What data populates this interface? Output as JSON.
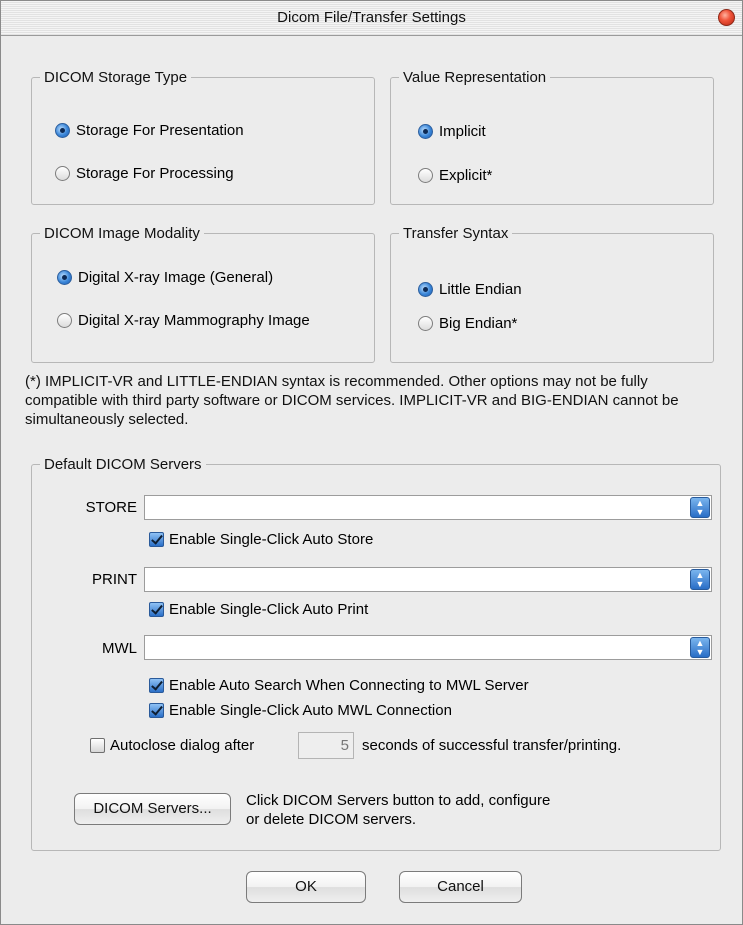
{
  "window": {
    "title": "Dicom File/Transfer Settings",
    "close_icon": "close-icon"
  },
  "storage_type": {
    "legend": "DICOM Storage Type",
    "options": [
      "Storage For Presentation",
      "Storage For Processing"
    ],
    "selected": 0
  },
  "value_representation": {
    "legend": "Value Representation",
    "options": [
      "Implicit",
      "Explicit*"
    ],
    "selected": 0
  },
  "modality": {
    "legend": "DICOM Image Modality",
    "options": [
      "Digital X-ray Image (General)",
      "Digital X-ray Mammography Image"
    ],
    "selected": 0
  },
  "transfer_syntax": {
    "legend": "Transfer Syntax",
    "options": [
      "Little Endian",
      "Big Endian*"
    ],
    "selected": 0
  },
  "note": "(*) IMPLICIT-VR  and LITTLE-ENDIAN syntax is recommended. Other options may not be fully compatible with third party software or DICOM services. IMPLICIT-VR and BIG-ENDIAN cannot be simultaneously selected.",
  "servers": {
    "legend": "Default DICOM Servers",
    "store_label": "STORE",
    "store_value": "",
    "store_check": "Enable Single-Click Auto Store",
    "print_label": "PRINT",
    "print_value": "",
    "print_check": "Enable Single-Click Auto Print",
    "mwl_label": "MWL",
    "mwl_value": "",
    "mwl_check1": "Enable Auto Search When Connecting to MWL Server",
    "mwl_check2": "Enable Single-Click Auto MWL Connection",
    "autoclose_prefix": "Autoclose dialog after",
    "autoclose_value": "5",
    "autoclose_suffix": "seconds of successful transfer/printing.",
    "autoclose_checked": false,
    "servers_button": "DICOM Servers...",
    "servers_hint_line1": "Click DICOM Servers button to add, configure",
    "servers_hint_line2": "or delete DICOM servers."
  },
  "buttons": {
    "ok": "OK",
    "cancel": "Cancel"
  },
  "colors": {
    "window_bg": "#ececec",
    "accent": "#2a6ec6",
    "close_red": "#e0442a"
  }
}
